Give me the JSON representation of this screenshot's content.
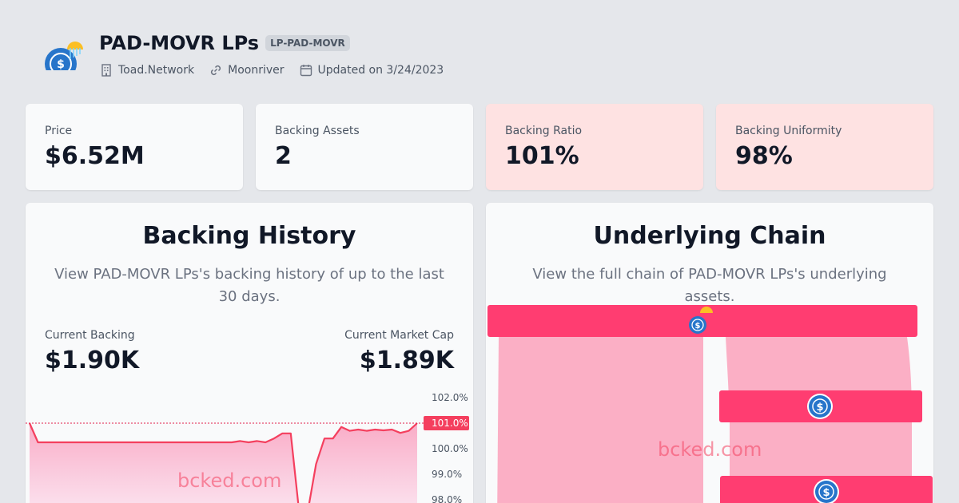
{
  "header": {
    "title": "PAD-MOVR LPs",
    "ticker": "LP-PAD-MOVR",
    "issuer": "Toad.Network",
    "chain": "Moonriver",
    "updated": "Updated on 3/24/2023"
  },
  "stats": [
    {
      "label": "Price",
      "value": "$6.52M",
      "status": "neutral"
    },
    {
      "label": "Backing Assets",
      "value": "2",
      "status": "neutral"
    },
    {
      "label": "Backing Ratio",
      "value": "101%",
      "status": "warn"
    },
    {
      "label": "Backing Uniformity",
      "value": "98%",
      "status": "warn"
    }
  ],
  "history": {
    "title": "Backing History",
    "description": "View PAD-MOVR LPs's backing history of up to the last 30 days.",
    "current_backing_label": "Current Backing",
    "current_backing_value": "$1.90K",
    "market_cap_label": "Current Market Cap",
    "market_cap_value": "$1.89K",
    "watermark": "bcked.com"
  },
  "chain_panel": {
    "title": "Underlying Chain",
    "description": "View the full chain of PAD-MOVR LPs's underlying assets.",
    "watermark": "bcked.com"
  },
  "colors": {
    "accent": "#f43f5e",
    "band": "#ff3d71",
    "flow": "#fbafc5",
    "coin": "#2775ca",
    "sun": "#fbbf24"
  },
  "chart_data": {
    "type": "area",
    "ylabel": "",
    "xlabel": "",
    "ylim": [
      97.7,
      102.3
    ],
    "y_ticks": [
      "102.0%",
      "101.0%",
      "100.0%",
      "99.0%",
      "98.0%"
    ],
    "y_tick_values": [
      102.0,
      101.0,
      100.0,
      99.0,
      98.0
    ],
    "current_label": "101.0%",
    "current_value": 101.0,
    "series": [
      {
        "values": [
          101.0,
          100.25,
          100.25,
          100.25,
          100.25,
          100.25,
          100.25,
          100.25,
          100.25,
          100.25,
          100.25,
          100.25,
          100.25,
          100.25,
          100.25,
          100.25,
          100.25,
          100.25,
          100.25,
          100.25,
          100.25,
          100.25,
          100.25,
          100.25,
          100.25,
          100.3,
          100.25,
          100.3,
          100.25,
          100.4,
          100.6,
          100.6,
          97.5,
          97.5,
          99.4,
          100.4,
          100.4,
          100.85,
          100.7,
          100.75,
          100.7,
          100.75,
          100.72,
          100.75,
          100.62,
          100.7,
          101.0
        ]
      }
    ]
  }
}
